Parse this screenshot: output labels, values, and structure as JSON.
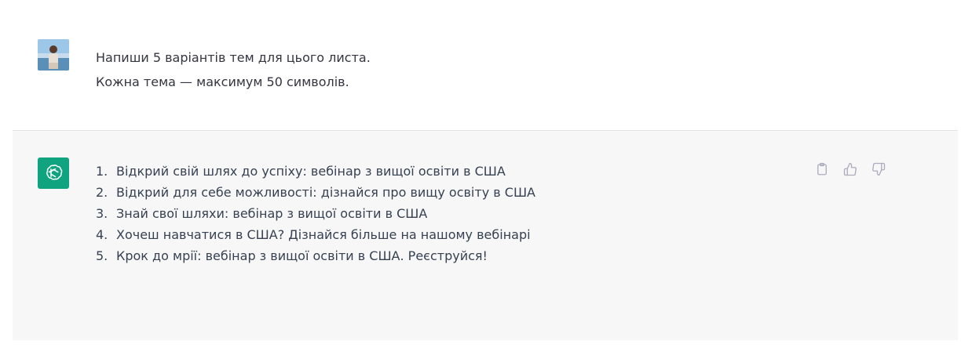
{
  "user_message": {
    "avatar": "user-photo-avatar",
    "lines": [
      "Напиши 5 варіантів тем для цього листа.",
      "Кожна тема — максимум 50 символів."
    ]
  },
  "assistant_message": {
    "avatar": "openai-logo-icon",
    "accent_color": "#10a37f",
    "items": [
      {
        "num": "1.",
        "text": "Відкрий свій шлях до успіху: вебінар з вищої освіти в США"
      },
      {
        "num": "2.",
        "text": "Відкрий для себе можливості: дізнайся про вищу освіту в США"
      },
      {
        "num": "3.",
        "text": "Знай свої шляхи: вебінар з вищої освіти в США"
      },
      {
        "num": "4.",
        "text": "Хочеш навчатися в США? Дізнайся більше на нашому вебінарі"
      },
      {
        "num": "5.",
        "text": "Крок до мрії: вебінар з вищої освіти в США. Реєструйся!"
      }
    ],
    "actions": [
      "clipboard-icon",
      "thumbs-up-icon",
      "thumbs-down-icon"
    ]
  }
}
